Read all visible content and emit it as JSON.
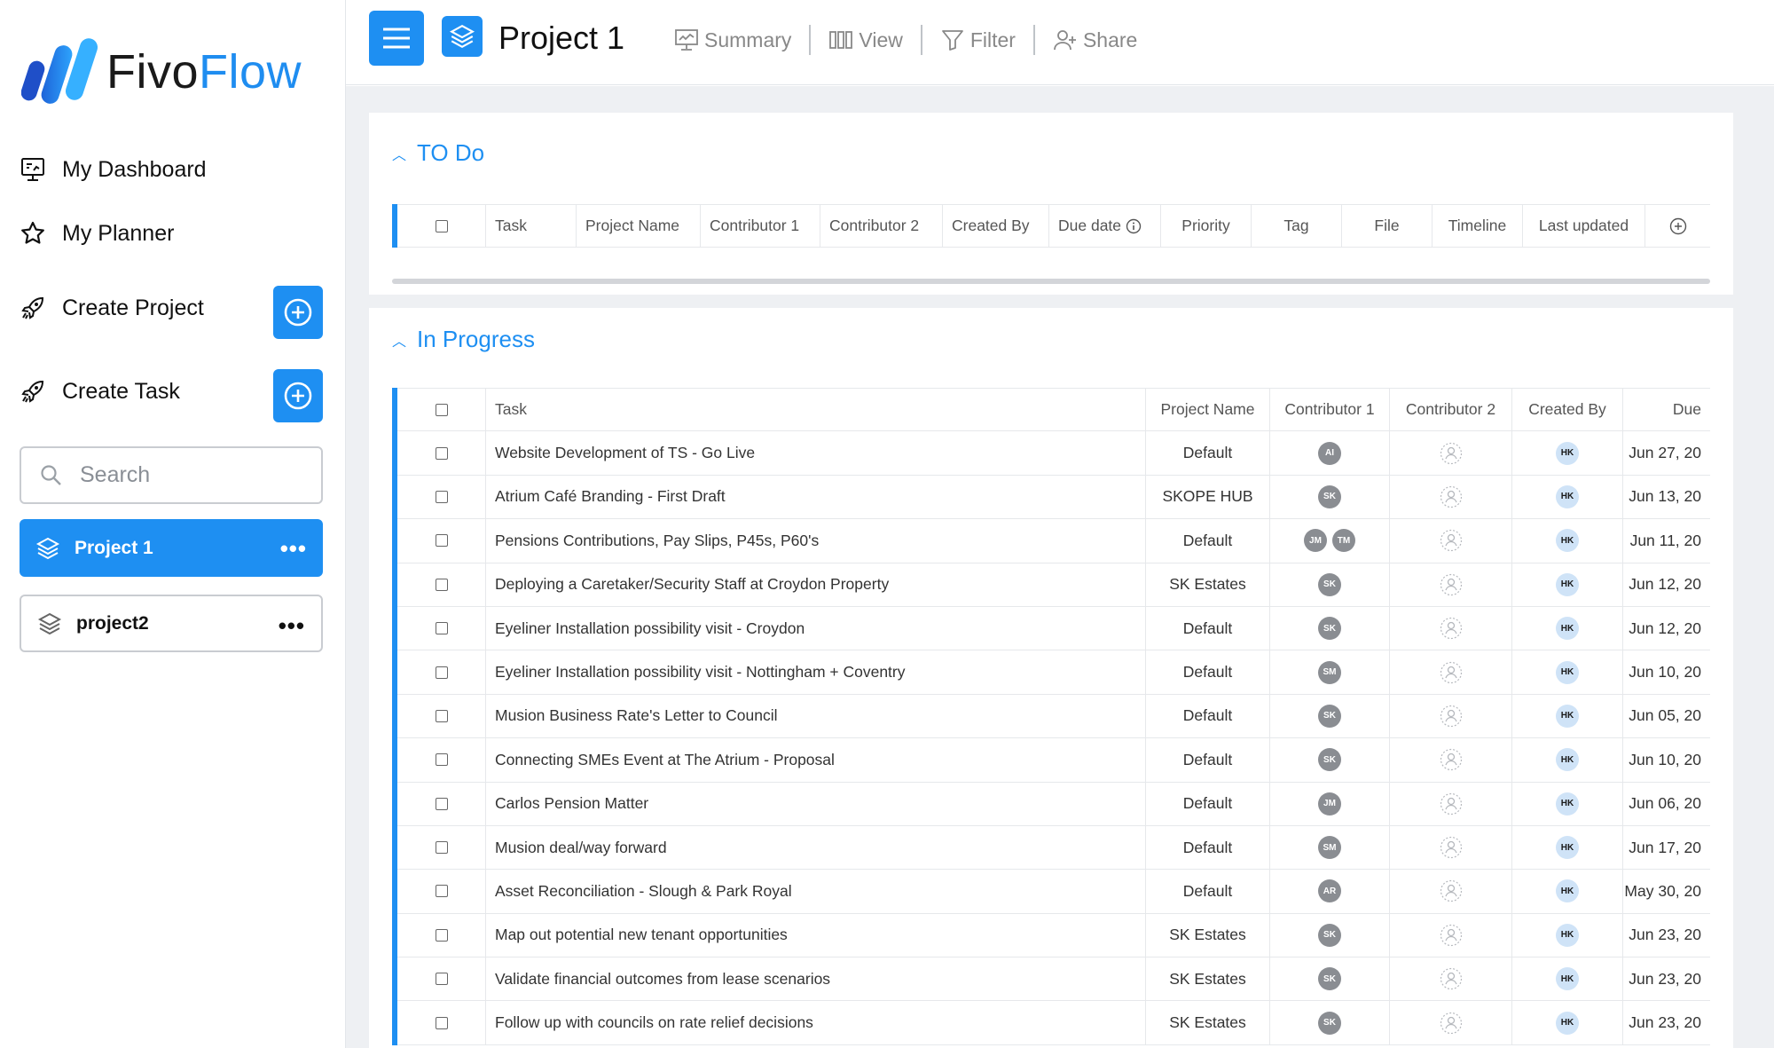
{
  "app": {
    "logo_part1": "Fivo",
    "logo_part2": "Flow"
  },
  "sidebar": {
    "dashboard": "My Dashboard",
    "planner": "My Planner",
    "create_project": "Create Project",
    "create_task": "Create Task",
    "search_placeholder": "Search",
    "projects": [
      {
        "name": "Project 1",
        "active": true
      },
      {
        "name": "project2",
        "active": false
      }
    ],
    "more": "•••"
  },
  "topbar": {
    "title": "Project 1",
    "summary": "Summary",
    "view": "View",
    "filter": "Filter",
    "share": "Share"
  },
  "todo": {
    "title": "TO Do",
    "columns": [
      "Task",
      "Project Name",
      "Contributor 1",
      "Contributor 2",
      "Created By",
      "Due date",
      "Priority",
      "Tag",
      "File",
      "Timeline",
      "Last updated"
    ]
  },
  "in_progress": {
    "title": "In Progress",
    "columns": [
      "Task",
      "Project Name",
      "Contributor 1",
      "Contributor 2",
      "Created By",
      "Due"
    ],
    "rows": [
      {
        "task": "Website Development of TS - Go Live",
        "project": "Default",
        "c1": [
          "AI"
        ],
        "created": "HK",
        "due": "Jun 27, 20"
      },
      {
        "task": "Atrium Café Branding - First Draft",
        "project": "SKOPE HUB",
        "c1": [
          "SK"
        ],
        "created": "HK",
        "due": "Jun 13, 20"
      },
      {
        "task": "Pensions Contributions, Pay Slips, P45s, P60's",
        "project": "Default",
        "c1": [
          "JM",
          "TM"
        ],
        "created": "HK",
        "due": "Jun 11, 20"
      },
      {
        "task": "Deploying a Caretaker/Security Staff at Croydon Property",
        "project": "SK Estates",
        "c1": [
          "SK"
        ],
        "created": "HK",
        "due": "Jun 12, 20"
      },
      {
        "task": "Eyeliner Installation possibility visit - Croydon",
        "project": "Default",
        "c1": [
          "SK"
        ],
        "created": "HK",
        "due": "Jun 12, 20"
      },
      {
        "task": "Eyeliner Installation possibility visit - Nottingham + Coventry",
        "project": "Default",
        "c1": [
          "SM"
        ],
        "created": "HK",
        "due": "Jun 10, 20"
      },
      {
        "task": "Musion Business Rate's Letter to Council",
        "project": "Default",
        "c1": [
          "SK"
        ],
        "created": "HK",
        "due": "Jun 05, 20"
      },
      {
        "task": "Connecting SMEs Event at The Atrium - Proposal",
        "project": "Default",
        "c1": [
          "SK"
        ],
        "created": "HK",
        "due": "Jun 10, 20"
      },
      {
        "task": "Carlos Pension Matter",
        "project": "Default",
        "c1": [
          "JM"
        ],
        "created": "HK",
        "due": "Jun 06, 20"
      },
      {
        "task": "Musion deal/way forward",
        "project": "Default",
        "c1": [
          "SM"
        ],
        "created": "HK",
        "due": "Jun 17, 20"
      },
      {
        "task": "Asset Reconciliation - Slough & Park Royal",
        "project": "Default",
        "c1": [
          "AR"
        ],
        "created": "HK",
        "due": "May 30, 20"
      },
      {
        "task": "Map out potential new tenant opportunities",
        "project": "SK Estates",
        "c1": [
          "SK"
        ],
        "created": "HK",
        "due": "Jun 23, 20"
      },
      {
        "task": "Validate financial outcomes from lease scenarios",
        "project": "SK Estates",
        "c1": [
          "SK"
        ],
        "created": "HK",
        "due": "Jun 23, 20"
      },
      {
        "task": "Follow up with councils on rate relief decisions",
        "project": "SK Estates",
        "c1": [
          "SK"
        ],
        "created": "HK",
        "due": "Jun 23, 20"
      }
    ]
  }
}
